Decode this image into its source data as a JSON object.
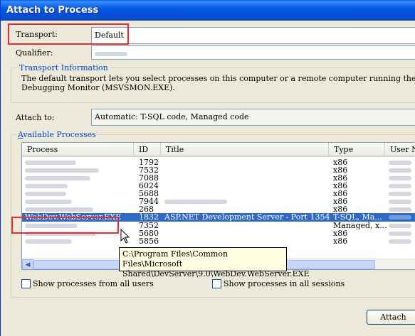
{
  "window": {
    "title": "Attach to Process"
  },
  "transport": {
    "label": "Transport:",
    "value": "Default"
  },
  "qualifier": {
    "label": "Qualifier:"
  },
  "transport_info": {
    "title": "Transport Information",
    "line1": "The default transport lets you select processes on this computer or a remote computer running the Microsoft Visual Stu",
    "line2": "Debugging Monitor (MSVSMON.EXE)."
  },
  "attach_to": {
    "label": "Attach to:",
    "value": "Automatic: T-SQL code, Managed code"
  },
  "available": {
    "title": "Available Processes",
    "columns": [
      "Process",
      "ID",
      "Title",
      "Type",
      "User N"
    ],
    "rows": [
      {
        "id": "1792",
        "title": "",
        "type": "x86"
      },
      {
        "id": "7532",
        "title": "",
        "type": "x86"
      },
      {
        "id": "7088",
        "title": "",
        "type": "x86"
      },
      {
        "id": "6024",
        "title": "",
        "type": "x86"
      },
      {
        "id": "5688",
        "title": "",
        "type": "x86"
      },
      {
        "id": "7944",
        "title": "",
        "type": "x86"
      },
      {
        "id": "268",
        "title": "",
        "type": "x86"
      },
      {
        "process": "WebDev.WebServer.EXE",
        "id": "1832",
        "title": "ASP.NET Development Server - Port 1354",
        "type": "T-SQL, Ma...",
        "selected": true
      },
      {
        "id": "7352",
        "title": "",
        "type": "Managed, x..."
      },
      {
        "id": "5680",
        "title": "",
        "type": "x86"
      },
      {
        "id": "5856",
        "title": "",
        "type": "x86"
      }
    ]
  },
  "tooltip": {
    "line1": "C:\\Program Files\\Common Files\\Microsoft",
    "line2": "Shared\\DevServer\\9.0\\WebDev.WebServer.EXE"
  },
  "checkboxes": {
    "all_users": "Show processes from all users",
    "all_sessions": "Show processes in all sessions"
  },
  "buttons": {
    "attach": "Attach"
  }
}
